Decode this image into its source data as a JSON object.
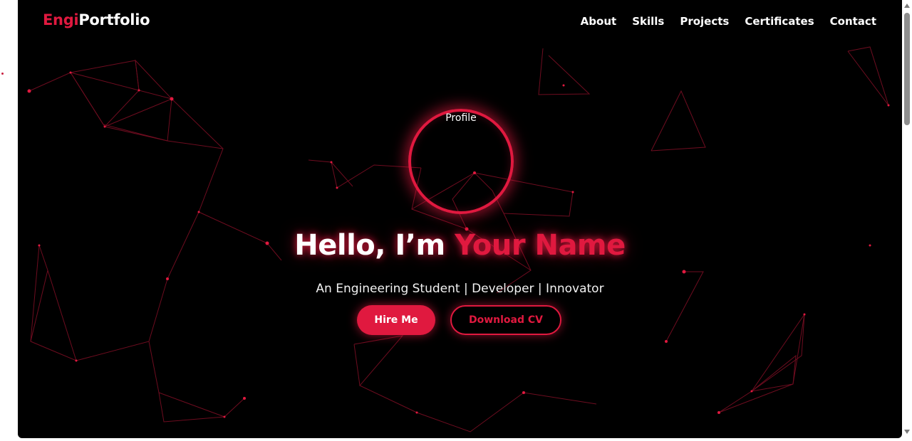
{
  "brand": {
    "part1": "Engi",
    "part2": "Portfolio"
  },
  "nav": {
    "items": [
      {
        "label": "About"
      },
      {
        "label": "Skills"
      },
      {
        "label": "Projects"
      },
      {
        "label": "Certificates"
      },
      {
        "label": "Contact"
      }
    ]
  },
  "hero": {
    "profile_label": "Profile",
    "greeting": "Hello, I’m ",
    "name": "Your Name",
    "tagline": "An Engineering Student | Developer | Innovator",
    "hire_label": "Hire Me",
    "cv_label": "Download CV"
  },
  "colors": {
    "accent": "#e0193f",
    "background": "#000000",
    "text": "#ffffff"
  }
}
